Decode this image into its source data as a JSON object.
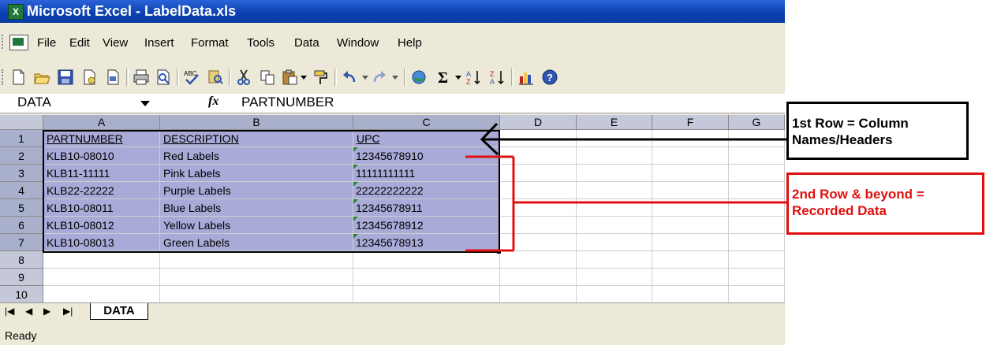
{
  "window": {
    "title": "Microsoft Excel - LabelData.xls",
    "app_icon": "X"
  },
  "menu": [
    "File",
    "Edit",
    "View",
    "Insert",
    "Format",
    "Tools",
    "Data",
    "Window",
    "Help"
  ],
  "toolbar": {
    "icons": [
      "new-icon",
      "open-icon",
      "save-icon",
      "permission-icon",
      "print-preview-icon",
      "print-icon",
      "preview-icon",
      "spelling-icon",
      "research-icon",
      "cut-icon",
      "copy-icon",
      "paste-icon",
      "format-painter-icon",
      "undo-icon",
      "redo-icon",
      "hyperlink-icon",
      "autosum-icon",
      "sort-ascending-icon",
      "sort-descending-icon",
      "chart-wizard-icon",
      "help-icon"
    ]
  },
  "formula_bar": {
    "name_box": "DATA",
    "fx_label": "fx",
    "value": "PARTNUMBER"
  },
  "columns": [
    "A",
    "B",
    "C",
    "D",
    "E",
    "F",
    "G"
  ],
  "rows": [
    "1",
    "2",
    "3",
    "4",
    "5",
    "6",
    "7",
    "8",
    "9",
    "10"
  ],
  "headers": [
    "PARTNUMBER",
    "DESCRIPTION",
    "UPC"
  ],
  "data_rows": [
    [
      "KLB10-08010",
      "Red Labels",
      "12345678910"
    ],
    [
      "KLB11-11111",
      "Pink Labels",
      "11111111111"
    ],
    [
      "KLB22-22222",
      "Purple Labels",
      "22222222222"
    ],
    [
      "KLB10-08011",
      "Blue Labels",
      "12345678911"
    ],
    [
      "KLB10-08012",
      "Yellow Labels",
      "12345678912"
    ],
    [
      "KLB10-08013",
      "Green Labels",
      "12345678913"
    ]
  ],
  "sheet_tab": "DATA",
  "status": "Ready",
  "annotations": {
    "header_note": "1st Row = Column Names/Headers",
    "data_note": "2nd Row & beyond = Recorded Data"
  },
  "colors": {
    "selection": "#a8aad8",
    "annotation_red": "#e01010",
    "text_number_marker": "#1a8a2a"
  }
}
